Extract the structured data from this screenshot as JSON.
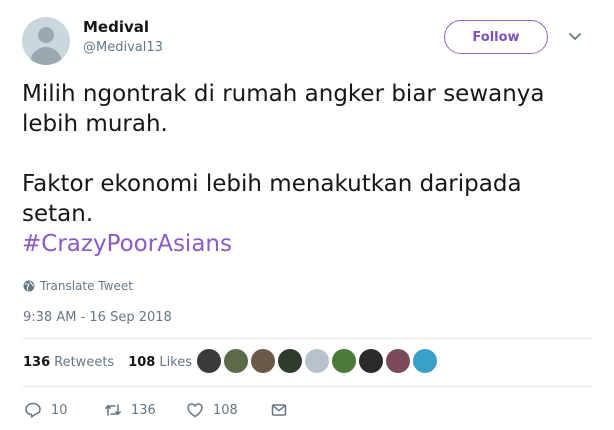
{
  "user": {
    "name": "Medival",
    "handle": "@Medival13"
  },
  "follow_label": "Follow",
  "tweet": {
    "line1": "Milih ngontrak di rumah angker biar sewanya lebih murah.",
    "line2": "Faktor ekonomi lebih menakutkan daripada setan.",
    "hashtag": "#CrazyPoorAsians"
  },
  "translate_label": "Translate Tweet",
  "timestamp": "9:38 AM - 16 Sep 2018",
  "stats": {
    "retweets_count": "136",
    "retweets_label": "Retweets",
    "likes_count": "108",
    "likes_label": "Likes"
  },
  "liker_colors": [
    "#3a3a3a",
    "#5b6b4a",
    "#6a5a4a",
    "#2f3b2f",
    "#b8c2cc",
    "#4a7a3a",
    "#2a2a2a",
    "#7a4a5a",
    "#3aa0c8"
  ],
  "actions": {
    "replies": "10",
    "retweets": "136",
    "likes": "108"
  },
  "colors": {
    "accent": "#8a5ac7",
    "muted": "#657786"
  }
}
